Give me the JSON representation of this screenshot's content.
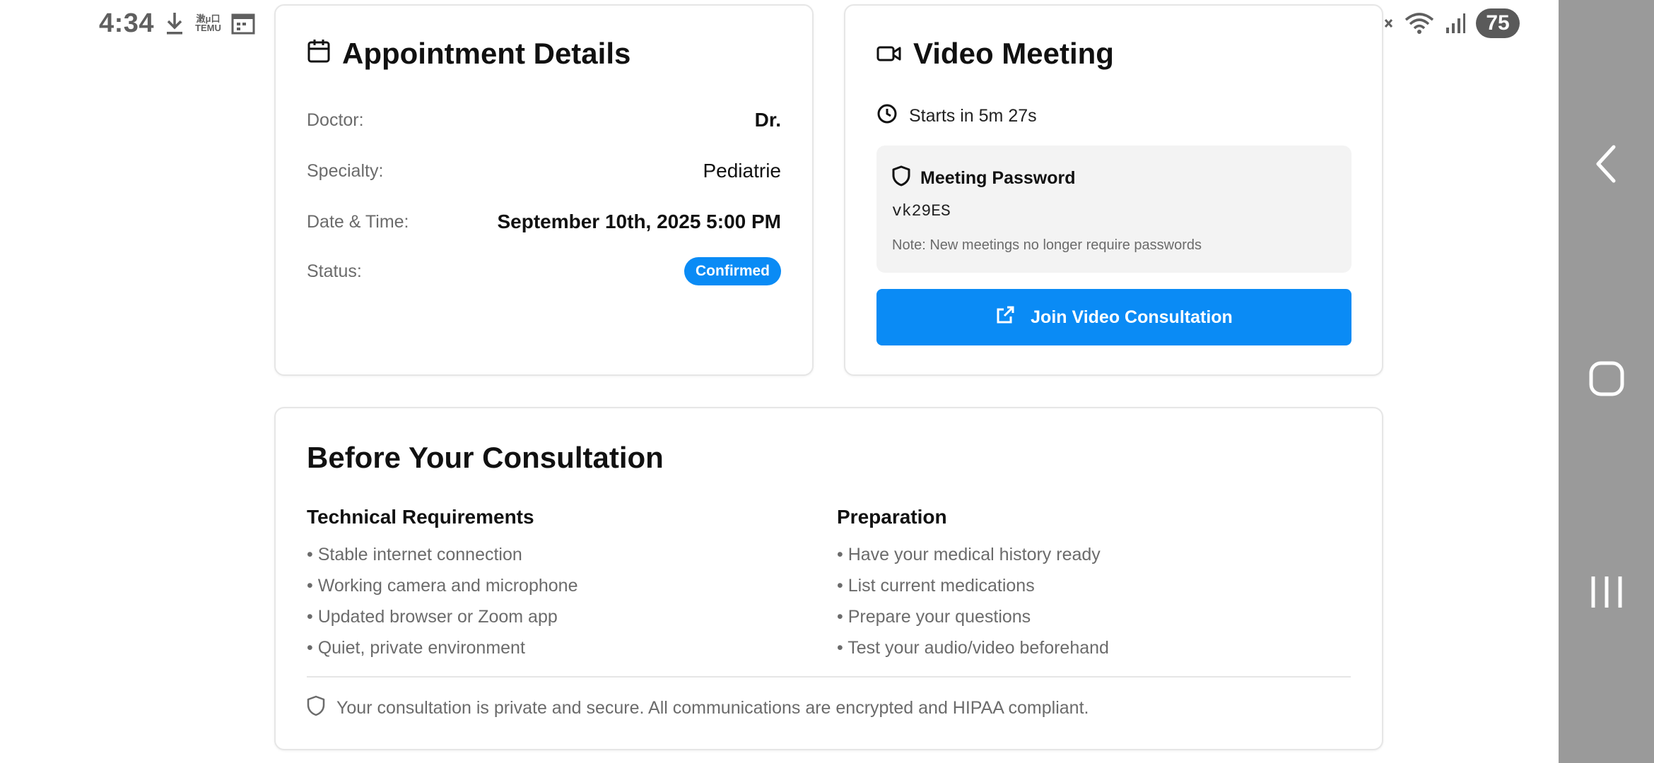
{
  "status_bar": {
    "time": "4:34",
    "left_icons": [
      "download-icon",
      "temu-icon",
      "calendar-icon"
    ],
    "temu_line1": "潄μ口",
    "temu_line2": "TEMU",
    "right_icons": [
      "mute-icon",
      "wifi-icon",
      "signal-icon"
    ],
    "battery": "75"
  },
  "appointment": {
    "title": "Appointment Details",
    "rows": [
      {
        "label": "Doctor:",
        "value": "Dr."
      },
      {
        "label": "Specialty:",
        "value": "Pediatrie"
      },
      {
        "label": "Date & Time:",
        "value": "September 10th, 2025 5:00 PM"
      },
      {
        "label": "Status:",
        "value": "Confirmed"
      }
    ]
  },
  "video": {
    "title": "Video Meeting",
    "starts": "Starts in 5m 27s",
    "password_title": "Meeting Password",
    "password": "vk29ES",
    "note": "Note: New meetings no longer require passwords",
    "join_label": "Join Video Consultation"
  },
  "before": {
    "title": "Before Your Consultation",
    "technical": {
      "title": "Technical Requirements",
      "items": [
        "• Stable internet connection",
        "• Working camera and microphone",
        "• Updated browser or Zoom app",
        "• Quiet, private environment"
      ]
    },
    "preparation": {
      "title": "Preparation",
      "items": [
        "• Have your medical history ready",
        "• List current medications",
        "• Prepare your questions",
        "• Test your audio/video beforehand"
      ]
    },
    "privacy": "Your consultation is private and secure. All communications are encrypted and HIPAA compliant."
  },
  "colors": {
    "accent": "#0a8bf5",
    "muted_text": "#6b6b6b",
    "nav_bar": "#9a9a9a"
  }
}
